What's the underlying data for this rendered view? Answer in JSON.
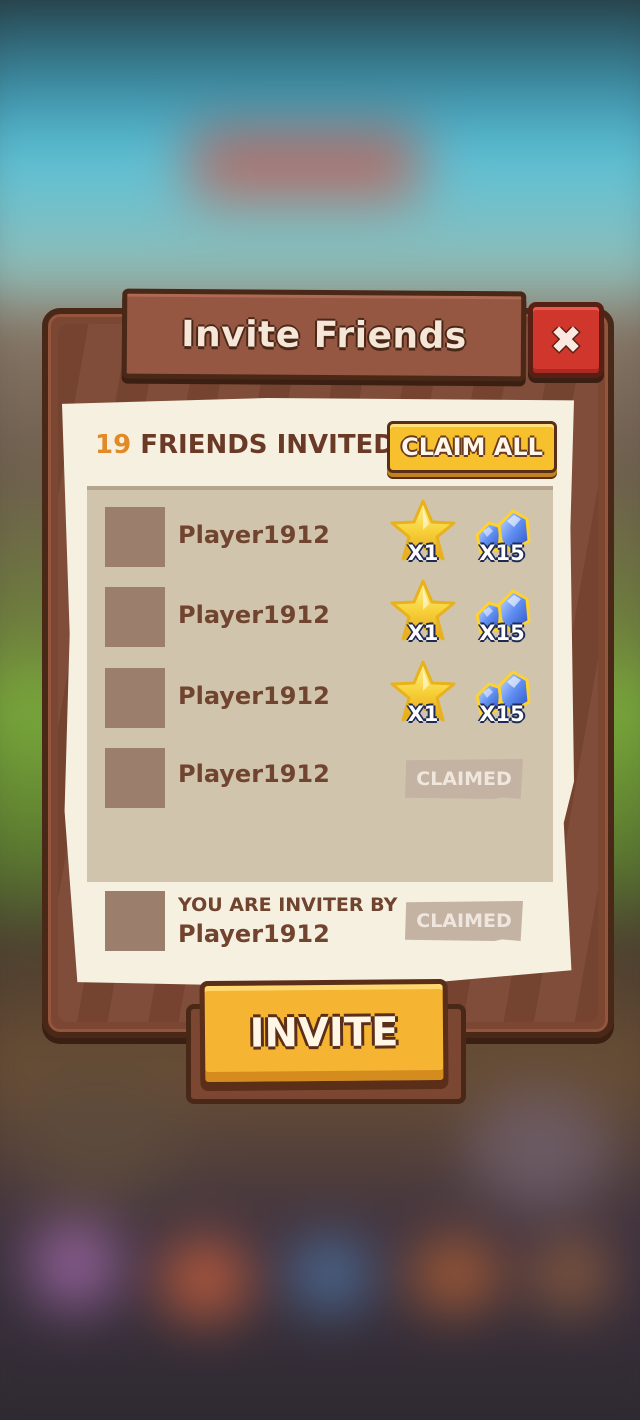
{
  "dialog": {
    "title": "Invite Friends",
    "close_icon": "✖"
  },
  "summary": {
    "count": "19",
    "label": "FRIENDS INVITED",
    "claim_all_label": "CLAIM ALL"
  },
  "friends": [
    {
      "name": "Player1912",
      "status": "claimable",
      "rewards": [
        {
          "icon": "star-icon",
          "count": "X1"
        },
        {
          "icon": "gem-icon",
          "count": "X15"
        }
      ]
    },
    {
      "name": "Player1912",
      "status": "claimable",
      "rewards": [
        {
          "icon": "star-icon",
          "count": "X1"
        },
        {
          "icon": "gem-icon",
          "count": "X15"
        }
      ]
    },
    {
      "name": "Player1912",
      "status": "claimable",
      "rewards": [
        {
          "icon": "star-icon",
          "count": "X1"
        },
        {
          "icon": "gem-icon",
          "count": "X15"
        }
      ]
    },
    {
      "name": "Player1912",
      "status": "claimed",
      "claimed_label": "CLAIMED"
    }
  ],
  "inviter": {
    "label": "YOU ARE INVITER BY",
    "name": "Player1912",
    "claimed_label": "CLAIMED"
  },
  "invite_button_label": "INVITE",
  "colors": {
    "wood": "#7b4733",
    "parchment": "#f6f0e1",
    "list_bg": "#d1c4ad",
    "accent_yellow": "#f7c12e",
    "count_orange": "#e28a26",
    "close_red": "#d0362c"
  }
}
